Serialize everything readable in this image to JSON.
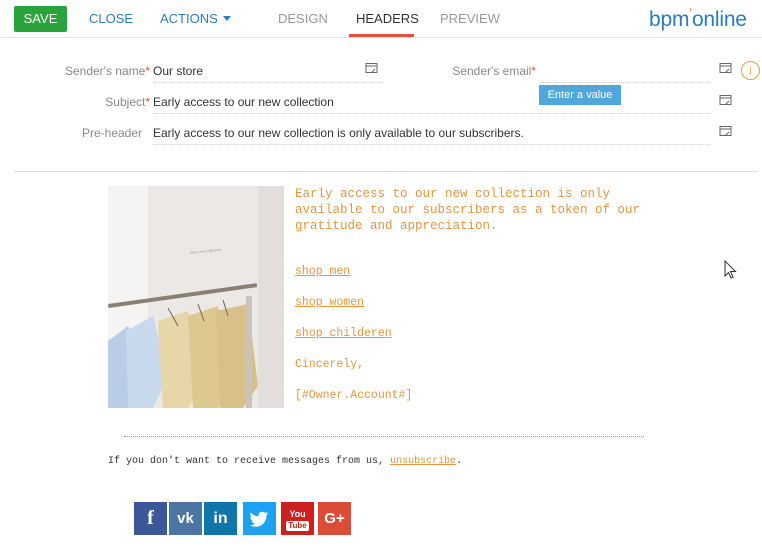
{
  "toolbar": {
    "save_label": "SAVE",
    "close_label": "CLOSE",
    "actions_label": "ACTIONS",
    "tabs": [
      {
        "label": "DESIGN",
        "active": false
      },
      {
        "label": "HEADERS",
        "active": true
      },
      {
        "label": "PREVIEW",
        "active": false
      }
    ],
    "logo_part1": "bpm",
    "logo_apos": "'",
    "logo_part2": "online"
  },
  "fields": {
    "sender_name": {
      "label": "Sender's name",
      "required_mark": "*",
      "value": "Our store"
    },
    "sender_email": {
      "label": "Sender's email",
      "required_mark": "*",
      "value": "",
      "tooltip": "Enter a value"
    },
    "subject": {
      "label": "Subject",
      "required_mark": "*",
      "value": "Early access to our new collection"
    },
    "preheader": {
      "label": "Pre-header",
      "value": "Early access to our new collection is only available to our subscribers."
    }
  },
  "email": {
    "headline": "Early access to our new collection is only available to our subscribers as a token of our gratitude and appreciation.",
    "links": [
      "shop men",
      "shop women",
      "shop childeren"
    ],
    "closing": "Cincerely,",
    "owner_macro": "[#Owner.Account#]",
    "unsubscribe_prefix": "If you don't want to receive messages from us,",
    "unsubscribe_link": "unsubscribe",
    "unsubscribe_suffix": ".",
    "image_caption": "Shop new collection"
  },
  "social": [
    {
      "name": "facebook",
      "glyph": "f",
      "color": "#3b5998"
    },
    {
      "name": "vk",
      "glyph": "vk",
      "color": "#4c75a3"
    },
    {
      "name": "linkedin",
      "glyph": "in",
      "color": "#0e76a8"
    },
    {
      "name": "twitter",
      "glyph": "twitter-bird",
      "color": "#1da1f2"
    },
    {
      "name": "youtube",
      "glyph_top": "You",
      "glyph_bottom": "Tube",
      "color": "#cd201f"
    },
    {
      "name": "google-plus",
      "glyph": "G+",
      "color": "#dd4b39"
    }
  ],
  "colors": {
    "accent": "#2b7bbf",
    "save": "#2ba33c",
    "active_tab": "#e3513c",
    "email_text": "#e89440"
  }
}
